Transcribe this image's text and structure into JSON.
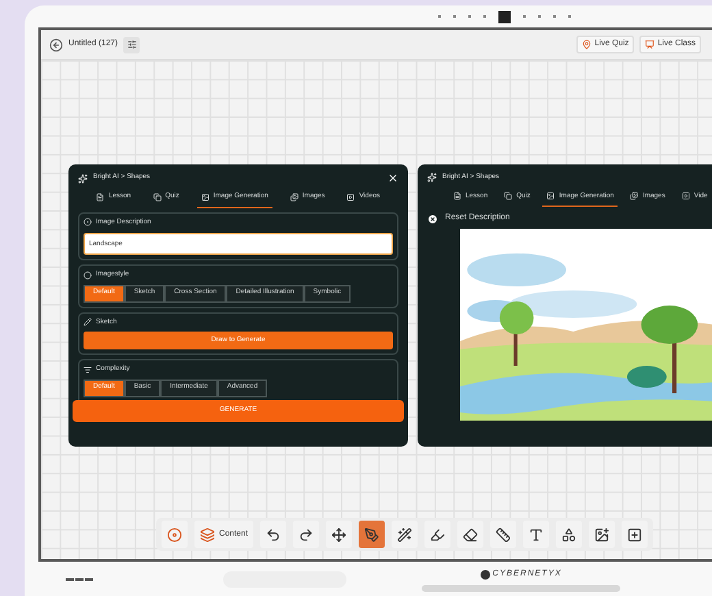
{
  "page_dots": [
    {
      "selected": false
    },
    {
      "selected": false
    },
    {
      "selected": false
    },
    {
      "selected": false
    },
    {
      "selected": true
    },
    {
      "selected": false
    },
    {
      "selected": false
    },
    {
      "selected": false
    },
    {
      "selected": false
    }
  ],
  "top_bar": {
    "title": "Untitled (127)",
    "buttons": [
      {
        "kind": "quiz",
        "label": "Live Quiz"
      },
      {
        "kind": "class",
        "label": "Live Class"
      }
    ]
  },
  "left_panel": {
    "breadcrumb": "Bright AI > Shapes",
    "tabs": [
      {
        "kind": "lesson",
        "label": "Lesson",
        "selected": false
      },
      {
        "kind": "quiz",
        "label": "Quiz",
        "selected": false
      },
      {
        "kind": "image",
        "label": "Image Generation",
        "selected": true
      },
      {
        "kind": "images",
        "label": "Images",
        "selected": false
      },
      {
        "kind": "video",
        "label": "Videos",
        "selected": false
      }
    ],
    "description": {
      "label": "Image Description",
      "value": "Landscape"
    },
    "image_style": {
      "label": "Imagestyle",
      "options": [
        {
          "label": "Default",
          "selected": true
        },
        {
          "label": "Sketch",
          "selected": false
        },
        {
          "label": "Cross Section",
          "selected": false
        },
        {
          "label": "Detailed Illustration",
          "selected": false
        },
        {
          "label": "Symbolic",
          "selected": false
        }
      ]
    },
    "sketch": {
      "label": "Sketch",
      "button": "Draw to Generate"
    },
    "complexity": {
      "label": "Complexity",
      "options": [
        {
          "label": "Default",
          "selected": true
        },
        {
          "label": "Basic",
          "selected": false
        },
        {
          "label": "Intermediate",
          "selected": false
        },
        {
          "label": "Advanced",
          "selected": false
        }
      ]
    },
    "generate": "GENERATE"
  },
  "right_panel": {
    "breadcrumb": "Bright AI > Shapes",
    "tabs": [
      {
        "kind": "lesson",
        "label": "Lesson",
        "selected": false
      },
      {
        "kind": "quiz",
        "label": "Quiz",
        "selected": false
      },
      {
        "kind": "image",
        "label": "Image Generation",
        "selected": true
      },
      {
        "kind": "images",
        "label": "Images",
        "selected": false
      },
      {
        "kind": "video",
        "label": "Vide",
        "selected": false
      }
    ],
    "reset": "Reset Description"
  },
  "toolbar": [
    {
      "kind": "record",
      "selected": false
    },
    {
      "kind": "content",
      "label": "Content",
      "selected": false
    },
    {
      "kind": "undo",
      "selected": false
    },
    {
      "kind": "redo",
      "selected": false
    },
    {
      "kind": "select",
      "selected": false
    },
    {
      "kind": "pen",
      "selected": true
    },
    {
      "kind": "magic",
      "selected": false
    },
    {
      "kind": "highlighter",
      "selected": false
    },
    {
      "kind": "eraser",
      "selected": false
    },
    {
      "kind": "ruler",
      "selected": false
    },
    {
      "kind": "text",
      "selected": false
    },
    {
      "kind": "shapes",
      "selected": false
    },
    {
      "kind": "image",
      "selected": false
    },
    {
      "kind": "add",
      "selected": false
    }
  ],
  "brand": "CYBERNETYX"
}
